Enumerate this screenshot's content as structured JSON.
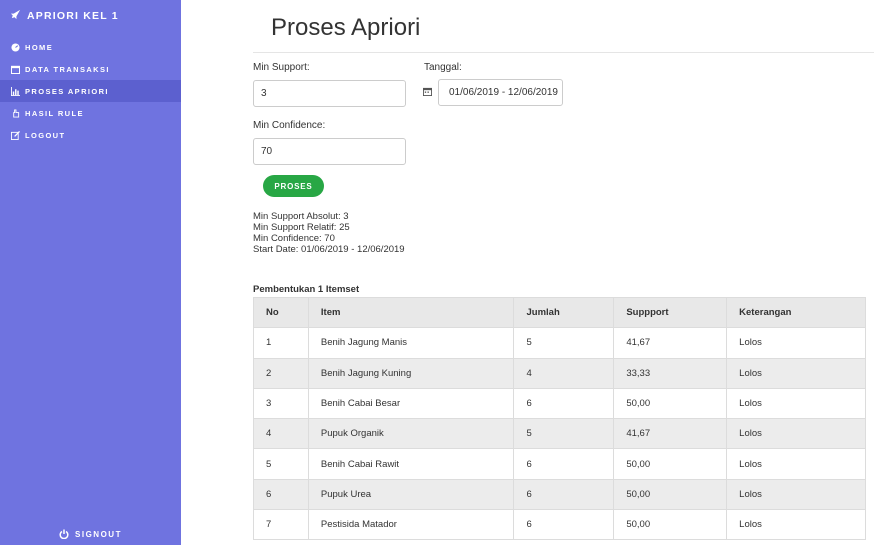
{
  "sidebar": {
    "brand": "APRIORI KEL 1",
    "items": [
      {
        "label": "HOME",
        "icon": "dashboard-icon"
      },
      {
        "label": "DATA TRANSAKSI",
        "icon": "calendar-icon"
      },
      {
        "label": "PROSES APRIORI",
        "icon": "bar-chart-icon"
      },
      {
        "label": "HASIL RULE",
        "icon": "hand-pointer-icon"
      },
      {
        "label": "LOGOUT",
        "icon": "edit-icon"
      }
    ],
    "active_index": 2,
    "signout": "SIGNOUT"
  },
  "page": {
    "title": "Proses Apriori"
  },
  "form": {
    "min_support_label": "Min Support:",
    "min_support_value": "3",
    "tanggal_label": "Tanggal:",
    "tanggal_value": "01/06/2019 - 12/06/2019",
    "min_confidence_label": "Min Confidence:",
    "min_confidence_value": "70",
    "proses_button": "PROSES"
  },
  "info": {
    "line1": "Min Support Absolut: 3",
    "line2": "Min Support Relatif: 25",
    "line3": "Min Confidence: 70",
    "line4": "Start Date: 01/06/2019 - 12/06/2019"
  },
  "itemset": {
    "title": "Pembentukan 1 Itemset",
    "headers": [
      "No",
      "Item",
      "Jumlah",
      "Suppport",
      "Keterangan"
    ],
    "rows": [
      [
        "1",
        "Benih Jagung Manis",
        "5",
        "41,67",
        "Lolos"
      ],
      [
        "2",
        "Benih Jagung Kuning",
        "4",
        "33,33",
        "Lolos"
      ],
      [
        "3",
        "Benih Cabai Besar",
        "6",
        "50,00",
        "Lolos"
      ],
      [
        "4",
        "Pupuk Organik",
        "5",
        "41,67",
        "Lolos"
      ],
      [
        "5",
        "Benih Cabai Rawit",
        "6",
        "50,00",
        "Lolos"
      ],
      [
        "6",
        "Pupuk Urea",
        "6",
        "50,00",
        "Lolos"
      ],
      [
        "7",
        "Pestisida Matador",
        "6",
        "50,00",
        "Lolos"
      ]
    ]
  },
  "colors": {
    "sidebar": "#6f73e0",
    "sidebar_active": "#5c60cf",
    "button": "#28a745"
  }
}
